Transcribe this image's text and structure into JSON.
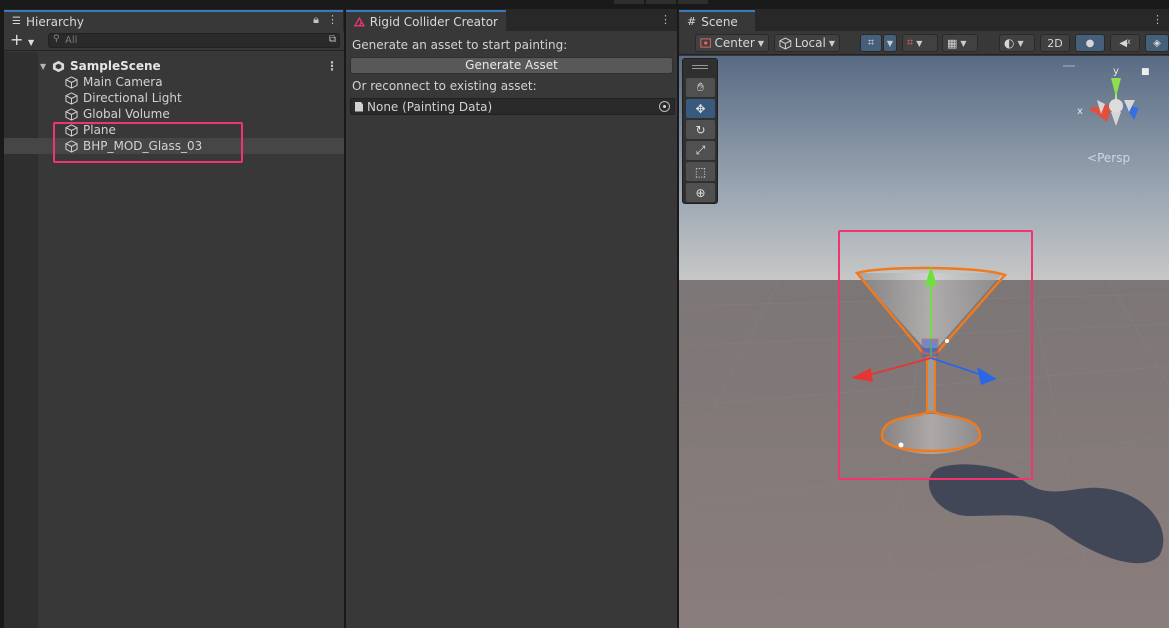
{
  "hierarchy": {
    "tab_title": "Hierarchy",
    "search_placeholder": "All",
    "scene_name": "SampleScene",
    "items": [
      {
        "label": "Main Camera"
      },
      {
        "label": "Directional Light"
      },
      {
        "label": "Global Volume"
      },
      {
        "label": "Plane"
      },
      {
        "label": "BHP_MOD_Glass_03",
        "selected": true
      }
    ]
  },
  "collider_creator": {
    "tab_title": "Rigid Collider Creator",
    "generate_prompt": "Generate an asset to start painting:",
    "generate_button": "Generate Asset",
    "reconnect_prompt": "Or reconnect to existing asset:",
    "asset_field_value": "None (Painting Data)"
  },
  "scene": {
    "tab_title": "Scene",
    "pivot_mode": "Center",
    "space_mode": "Local",
    "view_2d_label": "2D",
    "projection_label": "Persp",
    "axis_labels": {
      "x": "x",
      "y": "y"
    }
  },
  "colors": {
    "highlight": "#f0356e",
    "selection_outline": "#f07a1e",
    "accent_tab": "#3a79bb"
  }
}
